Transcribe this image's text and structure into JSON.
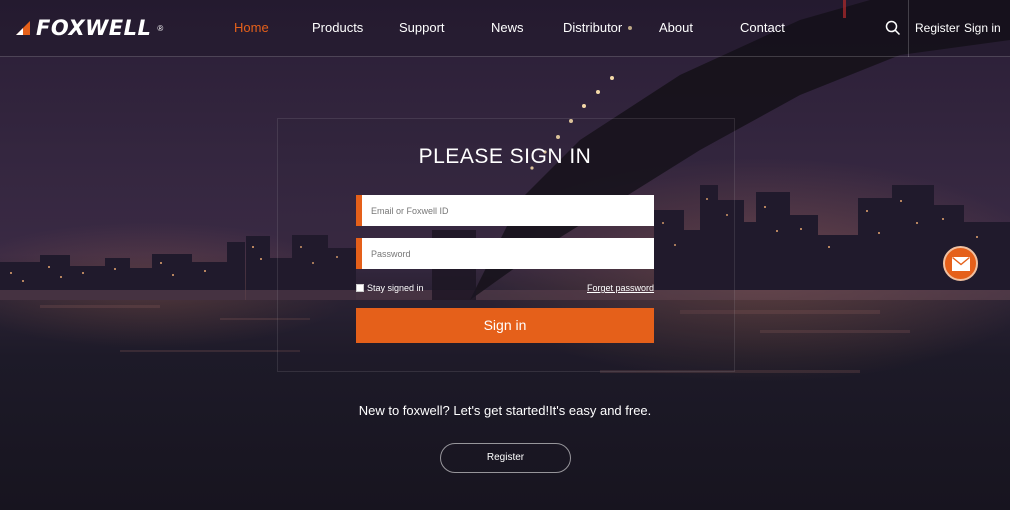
{
  "brand": {
    "name": "FOXWELL",
    "registered_mark": "®",
    "accent_color": "#e5601a"
  },
  "nav": {
    "items": [
      {
        "label": "Home",
        "active": true
      },
      {
        "label": "Products",
        "active": false
      },
      {
        "label": "Support",
        "active": false
      },
      {
        "label": "News",
        "active": false
      },
      {
        "label": "Distributor",
        "active": false
      },
      {
        "label": "About",
        "active": false
      },
      {
        "label": "Contact",
        "active": false
      }
    ],
    "search_icon": "search-icon",
    "register_label": "Register",
    "signin_label": "Sign in"
  },
  "login": {
    "title": "PLEASE SIGN IN",
    "email_placeholder": "Email or Foxwell ID",
    "email_value": "",
    "password_placeholder": "Password",
    "password_value": "",
    "stay_signed_in_label": "Stay signed in",
    "stay_signed_in_checked": false,
    "forget_password_label": "Forget password",
    "signin_button": "Sign in"
  },
  "signup": {
    "prompt": "New to foxwell? Let's get started!It's easy and free.",
    "register_button": "Register"
  },
  "floating": {
    "mail_icon": "mail-icon"
  }
}
